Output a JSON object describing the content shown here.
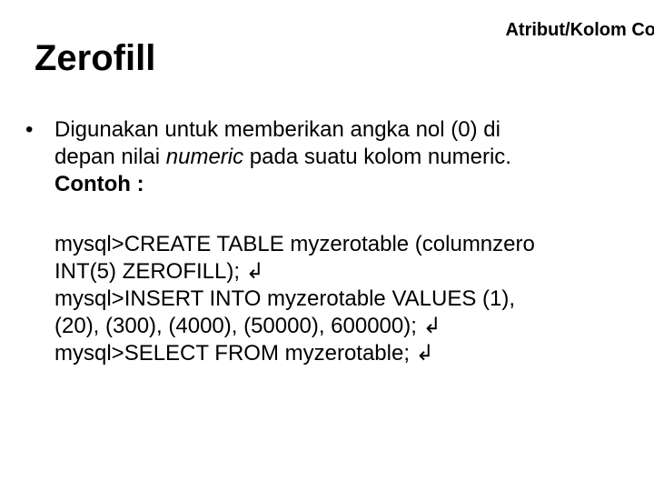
{
  "header": {
    "topRight": "Atribut/Kolom Co",
    "title": "Zerofill"
  },
  "bullet": {
    "marker": "•",
    "line1_pre": "Digunakan untuk memberikan angka nol (0) di",
    "line2_pre": "depan nilai ",
    "line2_italic": "numeric",
    "line2_post": "  pada suatu kolom numeric.",
    "line3_bold": "Contoh :"
  },
  "code": {
    "l1": "mysql>CREATE TABLE myzerotable (columnzero",
    "l2_text": "INT(5) ZEROFILL);",
    "l3": "mysql>INSERT INTO myzerotable VALUES (1),",
    "l4_text": "(20), (300), (4000), (50000), 600000);",
    "l5_text": "mysql>SELECT FROM myzerotable;",
    "return": " ↲"
  }
}
